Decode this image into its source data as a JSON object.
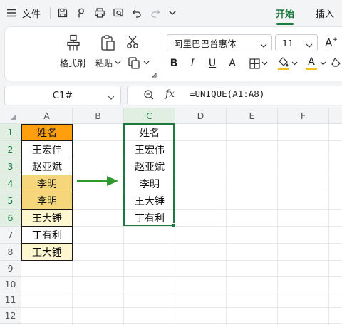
{
  "menubar": {
    "file_label": "文件",
    "tabs": [
      {
        "label": "开始",
        "active": true
      },
      {
        "label": "插入",
        "active": false
      }
    ]
  },
  "ribbon": {
    "format_painter_label": "格式刷",
    "paste_label": "粘贴",
    "font_name": "阿里巴巴普惠体",
    "font_size": "11",
    "bold_label": "B",
    "italic_label": "I",
    "underline_label": "U",
    "strike_label": "A",
    "grow_font_label": "A",
    "font_color_label": "A"
  },
  "formula_bar": {
    "name_box": "C1#",
    "fx_label": "fx",
    "formula": "=UNIQUE(A1:A8)"
  },
  "sheet": {
    "columns": [
      "A",
      "B",
      "C",
      "D",
      "E",
      "F"
    ],
    "rows": [
      "1",
      "2",
      "3",
      "4",
      "5",
      "6",
      "7",
      "8",
      "9",
      "10",
      "11",
      "12"
    ],
    "column_a": [
      "姓名",
      "王宏伟",
      "赵亚斌",
      "李明",
      "李明",
      "王大锤",
      "丁有利",
      "王大锤"
    ],
    "column_c": [
      "姓名",
      "王宏伟",
      "赵亚斌",
      "李明",
      "王大锤",
      "丁有利"
    ],
    "colors": {
      "header_fill": "#ff9f0e",
      "duplicate_fill": "#f5d67b",
      "highlight_fill": "#fdf6cf",
      "selection": "#1d7a3e",
      "arrow": "#2e9a2e"
    }
  }
}
